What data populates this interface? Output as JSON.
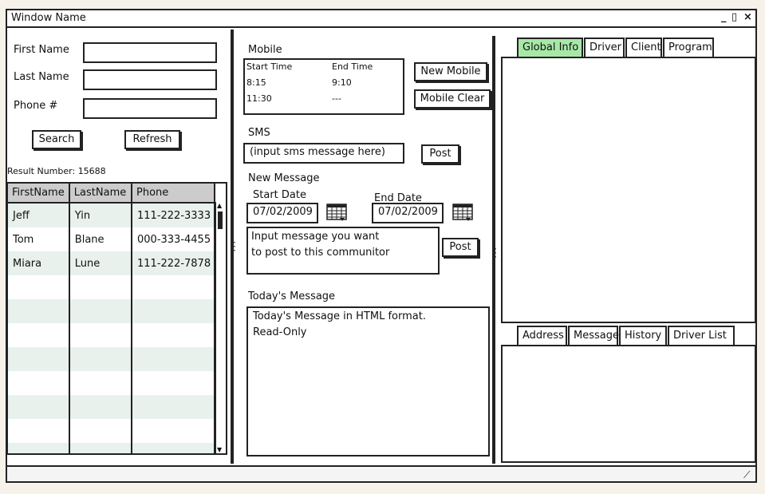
{
  "window": {
    "title": "Window Name",
    "min": "_",
    "max": "▯",
    "close": "×"
  },
  "search": {
    "first_name_label": "First Name",
    "last_name_label": "Last Name",
    "phone_label": "Phone #",
    "first_name_value": "",
    "last_name_value": "",
    "phone_value": "",
    "search_button": "Search",
    "refresh_button": "Refresh",
    "result_number_label": "Result Number:",
    "result_number": "15688"
  },
  "results": {
    "columns": [
      "FirstName",
      "LastName",
      "Phone"
    ],
    "rows": [
      [
        "Jeff",
        "Yin",
        "111-222-3333"
      ],
      [
        "Tom",
        "Blane",
        "000-333-4455"
      ],
      [
        "Miara",
        "Lune",
        "111-222-7878"
      ]
    ]
  },
  "mobile": {
    "heading": "Mobile",
    "start_time_header": "Start Time",
    "end_time_header": "End Time",
    "rows": [
      [
        "8:15",
        "9:10"
      ],
      [
        "11:30",
        "---"
      ]
    ],
    "new_mobile_button": "New Mobile",
    "mobile_clear_button": "Mobile Clear"
  },
  "sms": {
    "heading": "SMS",
    "input_value": "(input sms message here)",
    "post_button": "Post"
  },
  "new_message": {
    "heading": "New Message",
    "start_date_label": "Start Date",
    "end_date_label": "End Date",
    "start_date": "07/02/2009",
    "end_date": "07/02/2009",
    "message_line1": "Input message you want",
    "message_line2": "to post to this communitor",
    "post_button": "Post"
  },
  "today": {
    "heading": "Today's Message",
    "line1": "Today's Message in HTML format.",
    "line2": "Read-Only"
  },
  "top_tabs": [
    "Global Info",
    "Driver",
    "Client",
    "Program"
  ],
  "bottom_tabs": [
    "Address",
    "Message",
    "History",
    "Driver List"
  ],
  "colors": {
    "active_tab": "#a7e8a7",
    "header_bg": "#cccccc",
    "alt_row": "#e8f1ec"
  }
}
